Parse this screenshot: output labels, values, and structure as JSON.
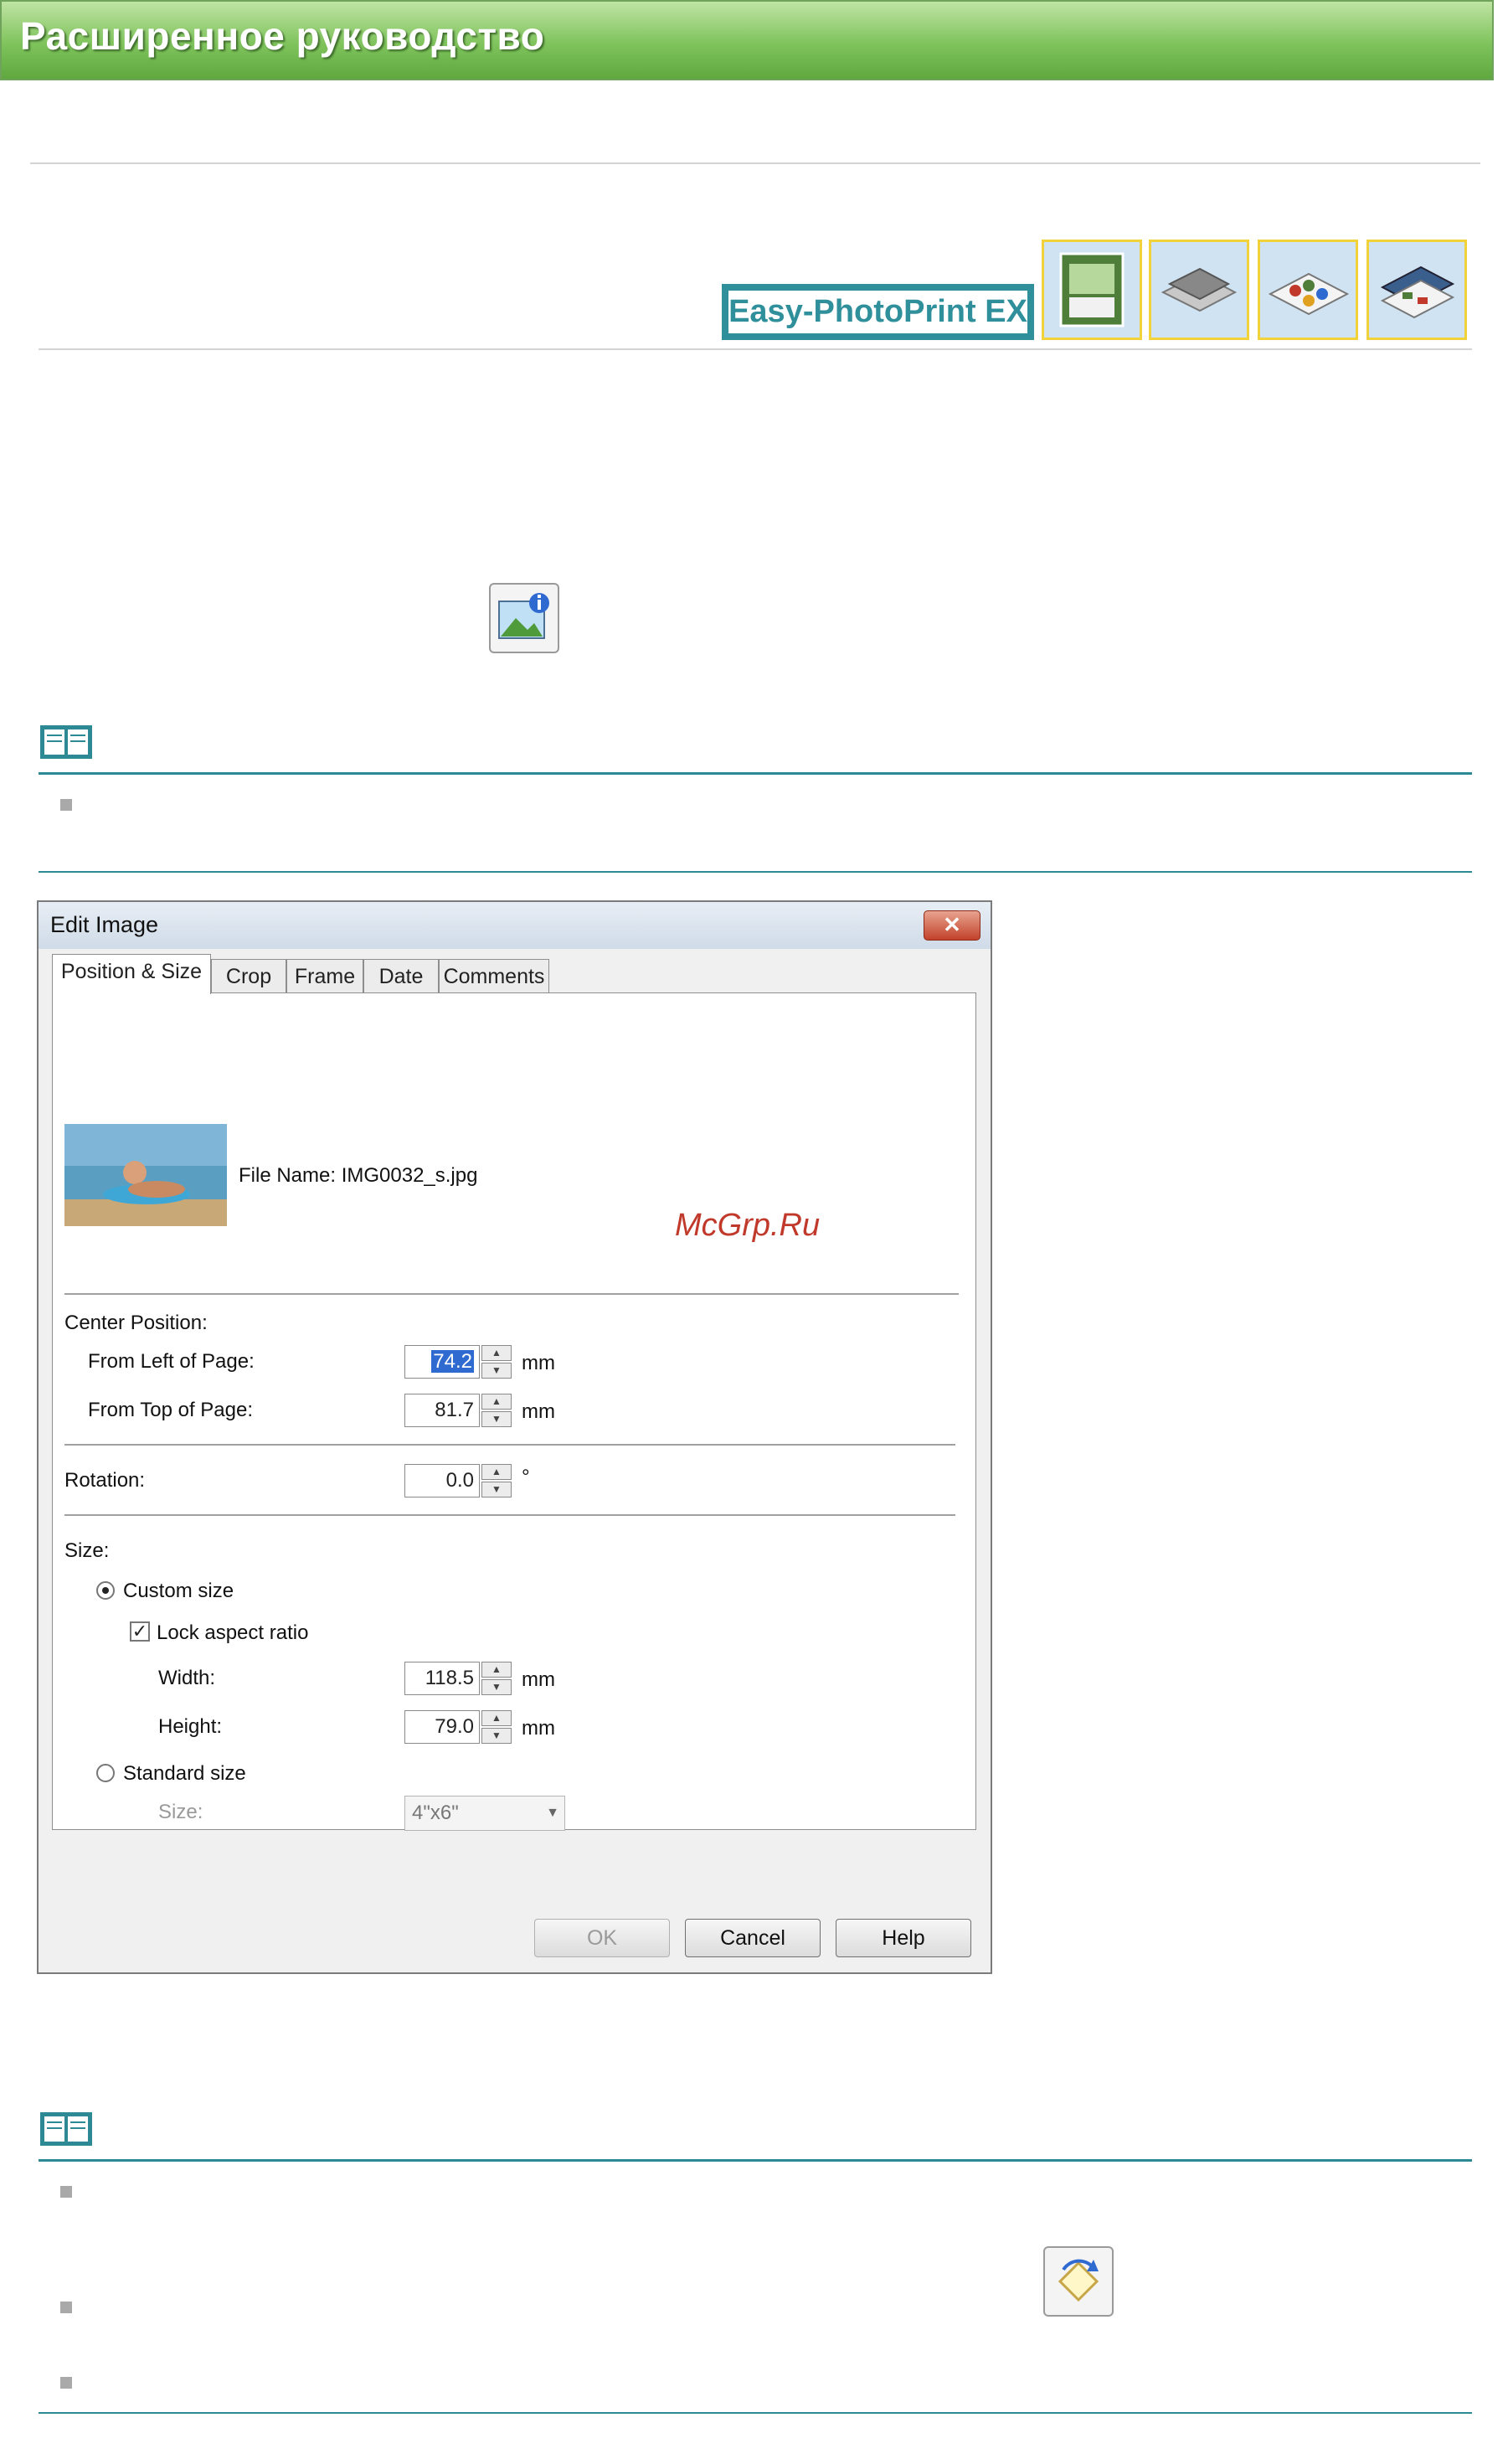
{
  "banner": {
    "title": "Расширенное руководство"
  },
  "logo": {
    "text": "Easy-PhotoPrint EX"
  },
  "header_icons": [
    "album-icon",
    "photo-layout-icon",
    "stickers-icon",
    "calendar-layout-icon"
  ],
  "icons": {
    "image_info": "image-info-icon",
    "rotate": "rotate-icon",
    "note": "note-book-icon"
  },
  "dialog": {
    "title": "Edit Image",
    "close_label": "✕",
    "tabs": [
      {
        "label": "Position & Size"
      },
      {
        "label": "Crop"
      },
      {
        "label": "Frame"
      },
      {
        "label": "Date"
      },
      {
        "label": "Comments"
      }
    ],
    "file_name_label": "File Name: IMG0032_s.jpg",
    "center_position_label": "Center Position:",
    "from_left_label": "From Left of Page:",
    "from_left_value": "74.2",
    "from_top_label": "From Top of Page:",
    "from_top_value": "81.7",
    "rotation_label": "Rotation:",
    "rotation_value": "0.0",
    "unit_mm": "mm",
    "unit_deg": "°",
    "size_label": "Size:",
    "custom_size_label": "Custom size",
    "lock_aspect_label": "Lock aspect ratio",
    "width_label": "Width:",
    "width_value": "118.5",
    "height_label": "Height:",
    "height_value": "79.0",
    "standard_size_label": "Standard size",
    "std_size_label": "Size:",
    "std_size_value": "4\"x6\"",
    "ok_label": "OK",
    "cancel_label": "Cancel",
    "help_label": "Help"
  },
  "watermark": "McGrp.Ru"
}
